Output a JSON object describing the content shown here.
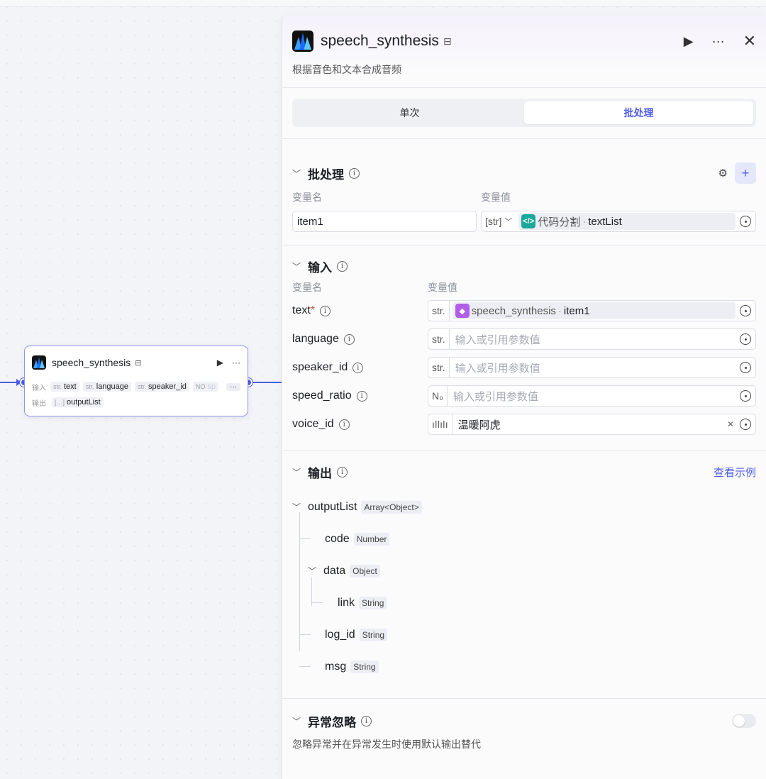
{
  "node": {
    "title": "speech_synthesis",
    "input_label": "输入",
    "output_label": "输出",
    "inputs": [
      {
        "type": "str.",
        "name": "text"
      },
      {
        "type": "str.",
        "name": "language"
      },
      {
        "type": "str.",
        "name": "speaker_id"
      },
      {
        "type": "NO",
        "name": "sp"
      }
    ],
    "more": "···",
    "outputs": [
      {
        "type": "[…]",
        "name": "outputList"
      }
    ]
  },
  "panel": {
    "title": "speech_synthesis",
    "description": "根据音色和文本合成音频",
    "tabs": {
      "single": "单次",
      "batch": "批处理"
    },
    "batch": {
      "title": "批处理",
      "col_name": "变量名",
      "col_value": "变量值",
      "var_name": "item1",
      "type_label": "[str]",
      "ref_source": "代码分割",
      "ref_field": "textList"
    },
    "input": {
      "title": "输入",
      "col_name": "变量名",
      "col_value": "变量值",
      "rows": [
        {
          "name": "text",
          "required": "*",
          "type": "str.",
          "ref_source": "speech_synthesis",
          "ref_field": "item1"
        },
        {
          "name": "language",
          "type": "str.",
          "placeholder": "输入或引用参数值"
        },
        {
          "name": "speaker_id",
          "type": "str.",
          "placeholder": "输入或引用参数值"
        },
        {
          "name": "speed_ratio",
          "type": "N₀",
          "placeholder": "输入或引用参数值"
        },
        {
          "name": "voice_id",
          "value": "温暖阿虎"
        }
      ]
    },
    "output": {
      "title": "输出",
      "example_link": "查看示例",
      "tree": [
        {
          "name": "outputList",
          "type": "Array<Object>"
        },
        {
          "name": "code",
          "type": "Number"
        },
        {
          "name": "data",
          "type": "Object"
        },
        {
          "name": "link",
          "type": "String"
        },
        {
          "name": "log_id",
          "type": "String"
        },
        {
          "name": "msg",
          "type": "String"
        }
      ]
    },
    "exception": {
      "title": "异常忽略",
      "description": "忽略异常并在异常发生时使用默认输出替代"
    }
  },
  "colors": {
    "accent": "#4e5de4",
    "code_icon": "#1aa89a",
    "node_icon": "#b15ee8"
  }
}
